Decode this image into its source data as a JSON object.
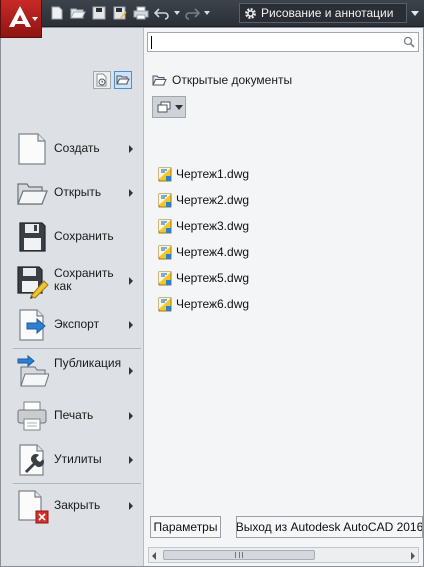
{
  "app": {
    "name": "Autodesk AutoCAD 2016",
    "logo_letter": "A",
    "brand_color": "#b01e1b"
  },
  "quick_access_toolbar": {
    "items": [
      "new-icon",
      "open-icon",
      "save-icon",
      "save-as-icon",
      "plot-icon",
      "undo-icon",
      "redo-icon"
    ]
  },
  "workspace": {
    "label": "Рисование и аннотации",
    "icon": "gear-icon"
  },
  "search": {
    "value": "",
    "placeholder": ""
  },
  "left_menu": {
    "view_modes": [
      "recent-documents-icon",
      "open-documents-icon"
    ],
    "active_view_mode": "open-documents-icon",
    "items": [
      {
        "label": "Создать",
        "icon": "new-document-icon",
        "has_submenu": true
      },
      {
        "label": "Открыть",
        "icon": "open-folder-icon",
        "has_submenu": true
      },
      {
        "label": "Сохранить",
        "icon": "floppy-disk-icon",
        "has_submenu": false
      },
      {
        "label": "Сохранить как",
        "icon": "save-as-icon",
        "has_submenu": true
      },
      {
        "label": "Экспорт",
        "icon": "export-icon",
        "has_submenu": true
      },
      {
        "label": "Публикация",
        "icon": "publish-icon",
        "has_submenu": true
      },
      {
        "label": "Печать",
        "icon": "printer-icon",
        "has_submenu": true
      },
      {
        "label": "Утилиты",
        "icon": "wrench-icon",
        "has_submenu": true
      },
      {
        "label": "Закрыть",
        "icon": "close-document-icon",
        "has_submenu": true
      }
    ]
  },
  "documents_panel": {
    "title": "Открытые документы",
    "title_icon": "folder-icon",
    "view_button_icon": "display-options-icon",
    "documents": [
      {
        "name": "Чертеж1.dwg"
      },
      {
        "name": "Чертеж2.dwg"
      },
      {
        "name": "Чертеж3.dwg"
      },
      {
        "name": "Чертеж4.dwg"
      },
      {
        "name": "Чертеж5.dwg"
      },
      {
        "name": "Чертеж6.dwg"
      }
    ]
  },
  "footer": {
    "options_label": "Параметры",
    "exit_label": "Выход из Autodesk AutoCAD 2016"
  }
}
